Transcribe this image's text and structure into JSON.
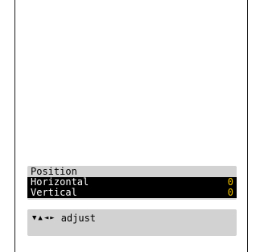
{
  "osd": {
    "title": "Position",
    "rows": [
      {
        "label": "Horizontal",
        "value": "0"
      },
      {
        "label": "Vertical",
        "value": "0"
      }
    ],
    "value_color": "#f0c000"
  },
  "hint": {
    "arrows": [
      "▼",
      "▲",
      "◄",
      "►"
    ],
    "text": "adjust"
  }
}
